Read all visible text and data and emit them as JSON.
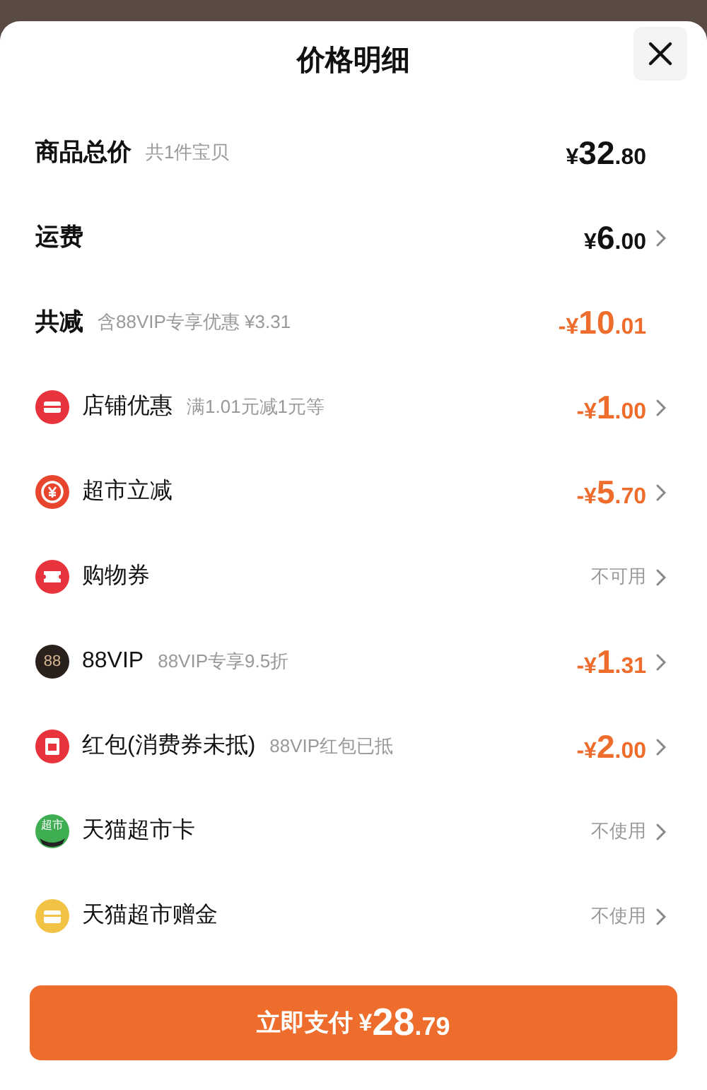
{
  "title": "价格明细",
  "rows": [
    {
      "kind": "summary",
      "label": "商品总价",
      "note": "共1件宝贝",
      "value": {
        "kind": "price",
        "discount": false,
        "currency": "¥",
        "whole": "32",
        "cents": ".80"
      },
      "arrow": false
    },
    {
      "kind": "summary",
      "label": "运费",
      "value": {
        "kind": "price",
        "discount": false,
        "currency": "¥",
        "whole": "6",
        "cents": ".00"
      },
      "arrow": true
    },
    {
      "kind": "summary",
      "label": "共减",
      "note": "含88VIP专享优惠 ¥3.31",
      "value": {
        "kind": "price",
        "discount": true,
        "sign": "-",
        "currency": "¥",
        "whole": "10",
        "cents": ".01"
      },
      "arrow": false
    },
    {
      "kind": "item",
      "label": "店铺优惠",
      "note": "满1.01元减1元等",
      "value": {
        "kind": "price",
        "discount": true,
        "sign": "-",
        "currency": "¥",
        "whole": "1",
        "cents": ".00"
      },
      "arrow": true
    },
    {
      "kind": "item",
      "label": "超市立减",
      "value": {
        "kind": "price",
        "discount": true,
        "sign": "-",
        "currency": "¥",
        "whole": "5",
        "cents": ".70"
      },
      "arrow": true
    },
    {
      "kind": "item",
      "label": "购物券",
      "value": {
        "kind": "text",
        "text": "不可用"
      },
      "arrow": true
    },
    {
      "kind": "item",
      "icon_text": "88",
      "label": "88VIP",
      "note": "88VIP专享9.5折",
      "value": {
        "kind": "price",
        "discount": true,
        "sign": "-",
        "currency": "¥",
        "whole": "1",
        "cents": ".31"
      },
      "arrow": true
    },
    {
      "kind": "item",
      "label": "红包(消费券未抵)",
      "note": "88VIP红包已抵",
      "value": {
        "kind": "price",
        "discount": true,
        "sign": "-",
        "currency": "¥",
        "whole": "2",
        "cents": ".00"
      },
      "arrow": true
    },
    {
      "kind": "item",
      "icon_text": "超市",
      "label": "天猫超市卡",
      "value": {
        "kind": "text",
        "text": "不使用"
      },
      "arrow": true
    },
    {
      "kind": "item",
      "label": "天猫超市赠金",
      "value": {
        "kind": "text",
        "text": "不使用"
      },
      "arrow": true
    }
  ],
  "pay_button": {
    "label": "立即支付",
    "currency": "¥",
    "whole": "28",
    "cents": ".79"
  }
}
